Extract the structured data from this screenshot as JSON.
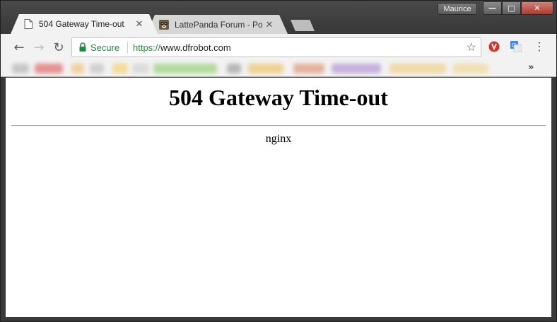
{
  "window": {
    "profile_name": "Maurice",
    "minimize_glyph": "—",
    "maximize_glyph": "□",
    "close_glyph": "✕"
  },
  "tabs": [
    {
      "title": "504 Gateway Time-out",
      "icon": "page-icon",
      "active": true,
      "close_glyph": "✕"
    },
    {
      "title": "LattePanda Forum - Post",
      "icon": "lattepanda-favicon",
      "active": false,
      "close_glyph": "✕"
    }
  ],
  "toolbar": {
    "back_glyph": "←",
    "forward_glyph": "→",
    "reload_glyph": "↻",
    "secure_label": "Secure",
    "url_scheme": "https://",
    "url_host": "www.dfrobot.com",
    "star_glyph": "☆",
    "menu_glyph": "⋮"
  },
  "bookmarks": {
    "more_glyph": "»"
  },
  "page": {
    "heading": "504 Gateway Time-out",
    "server": "nginx"
  },
  "colors": {
    "secure_green": "#1e8e3e",
    "close_red": "#b03a2e"
  }
}
